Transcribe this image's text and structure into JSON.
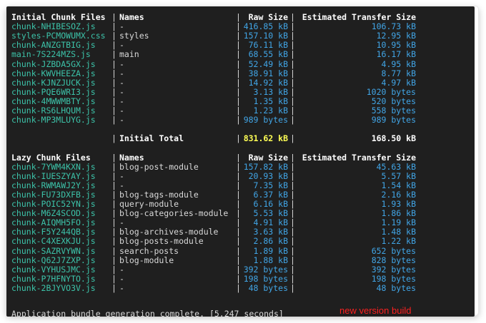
{
  "initial": {
    "header": {
      "files": "Initial Chunk Files",
      "names": "Names",
      "raw": "Raw Size",
      "est": "Estimated Transfer Size"
    },
    "rows": [
      {
        "file": "chunk-NHIBESOZ.js",
        "name": "-",
        "raw": "416.85 kB",
        "est": "106.73 kB"
      },
      {
        "file": "styles-PCMOWUMX.css",
        "name": "styles",
        "raw": "157.10 kB",
        "est": "12.95 kB"
      },
      {
        "file": "chunk-ANZGTBIG.js",
        "name": "-",
        "raw": "76.11 kB",
        "est": "10.95 kB"
      },
      {
        "file": "main-7S224MZS.js",
        "name": "main",
        "raw": "68.55 kB",
        "est": "16.17 kB"
      },
      {
        "file": "chunk-JZBDA5GX.js",
        "name": "-",
        "raw": "52.49 kB",
        "est": "4.95 kB"
      },
      {
        "file": "chunk-KWVHEEZA.js",
        "name": "-",
        "raw": "38.91 kB",
        "est": "8.77 kB"
      },
      {
        "file": "chunk-KJNZJUCK.js",
        "name": "-",
        "raw": "14.92 kB",
        "est": "4.97 kB"
      },
      {
        "file": "chunk-PQE6WRI3.js",
        "name": "-",
        "raw": "3.13 kB",
        "est": "1020 bytes"
      },
      {
        "file": "chunk-4MWWMBTY.js",
        "name": "-",
        "raw": "1.35 kB",
        "est": "520 bytes"
      },
      {
        "file": "chunk-RS6LHQUM.js",
        "name": "-",
        "raw": "1.23 kB",
        "est": "558 bytes"
      },
      {
        "file": "chunk-MP3MLUYG.js",
        "name": "-",
        "raw": "989 bytes",
        "est": "989 bytes"
      }
    ],
    "total": {
      "label": "Initial Total",
      "raw": "831.62 kB",
      "est": "168.50 kB"
    }
  },
  "lazy": {
    "header": {
      "files": "Lazy Chunk Files",
      "names": "Names",
      "raw": "Raw Size",
      "est": "Estimated Transfer Size"
    },
    "rows": [
      {
        "file": "chunk-7YWM4KXN.js",
        "name": "blog-post-module",
        "raw": "157.82 kB",
        "est": "45.63 kB"
      },
      {
        "file": "chunk-IUESZYAY.js",
        "name": "-",
        "raw": "20.93 kB",
        "est": "5.57 kB"
      },
      {
        "file": "chunk-RWMAWJ2Y.js",
        "name": "-",
        "raw": "7.35 kB",
        "est": "1.54 kB"
      },
      {
        "file": "chunk-FU73DXFB.js",
        "name": "blog-tags-module",
        "raw": "6.37 kB",
        "est": "2.16 kB"
      },
      {
        "file": "chunk-POIC52YN.js",
        "name": "query-module",
        "raw": "6.16 kB",
        "est": "1.93 kB"
      },
      {
        "file": "chunk-M6Z4SCOD.js",
        "name": "blog-categories-module",
        "raw": "5.53 kB",
        "est": "1.86 kB"
      },
      {
        "file": "chunk-AIQMH5FO.js",
        "name": "-",
        "raw": "4.91 kB",
        "est": "1.19 kB"
      },
      {
        "file": "chunk-F5Y244QB.js",
        "name": "blog-archives-module",
        "raw": "3.63 kB",
        "est": "1.48 kB"
      },
      {
        "file": "chunk-C4XEXKJU.js",
        "name": "blog-posts-module",
        "raw": "2.86 kB",
        "est": "1.22 kB"
      },
      {
        "file": "chunk-SAZRVYWN.js",
        "name": "search-posts",
        "raw": "1.89 kB",
        "est": "652 bytes"
      },
      {
        "file": "chunk-Q62J7ZXP.js",
        "name": "blog-module",
        "raw": "1.88 kB",
        "est": "828 bytes"
      },
      {
        "file": "chunk-VYHUSJMC.js",
        "name": "-",
        "raw": "392 bytes",
        "est": "392 bytes"
      },
      {
        "file": "chunk-P7HFNYTO.js",
        "name": "-",
        "raw": "198 bytes",
        "est": "198 bytes"
      },
      {
        "file": "chunk-2BJYVO3V.js",
        "name": "-",
        "raw": "48 bytes",
        "est": "48 bytes"
      }
    ]
  },
  "footer": {
    "message": "Application bundle generation complete. [5.247 seconds]"
  },
  "annotation": {
    "label": "new version build"
  },
  "colors": {
    "background": "#1f1f1f",
    "file": "#3cc3a9",
    "size": "#41a5e6",
    "total_raw": "#ffff55",
    "annotation": "#ff2020"
  },
  "pipe": "|"
}
